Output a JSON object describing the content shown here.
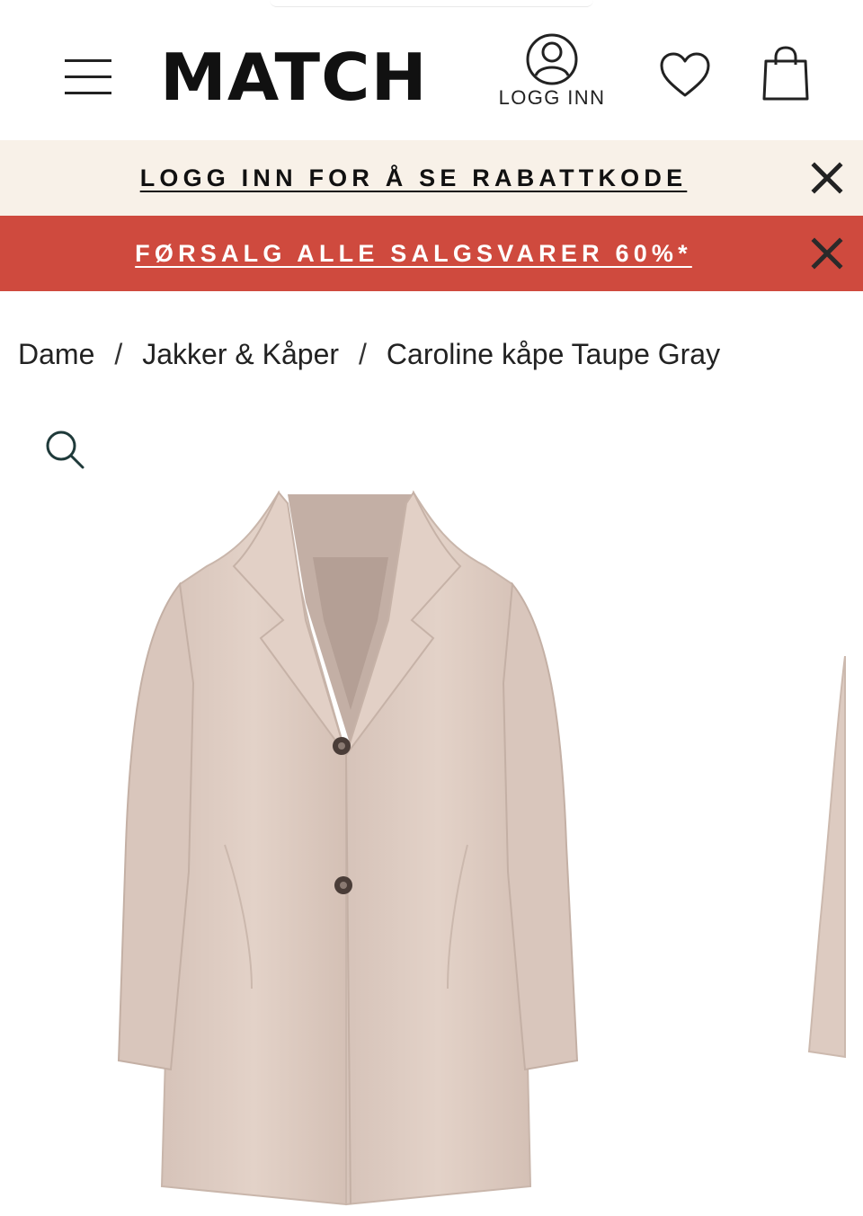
{
  "header": {
    "logo_text": "MATCH",
    "login_label": "LOGG INN",
    "icons": {
      "menu": "hamburger-menu-icon",
      "account": "user-icon",
      "wishlist": "heart-icon",
      "cart": "shopping-bag-icon"
    }
  },
  "banners": {
    "login": {
      "text": "LOGG INN FOR Å SE RABATTKODE",
      "background": "#f8f1e8",
      "close_icon": "close-icon"
    },
    "sale": {
      "text": "FØRSALG ALLE SALGSVARER 60%*",
      "background": "#cf4a3e",
      "close_icon": "close-icon"
    }
  },
  "breadcrumb": {
    "items": [
      "Dame",
      "Jakker & Kåper",
      "Caroline kåpe Taupe Gray"
    ],
    "separator": "/"
  },
  "gallery": {
    "zoom_icon": "magnifier-icon",
    "coat_color": "#ddcbc1"
  }
}
